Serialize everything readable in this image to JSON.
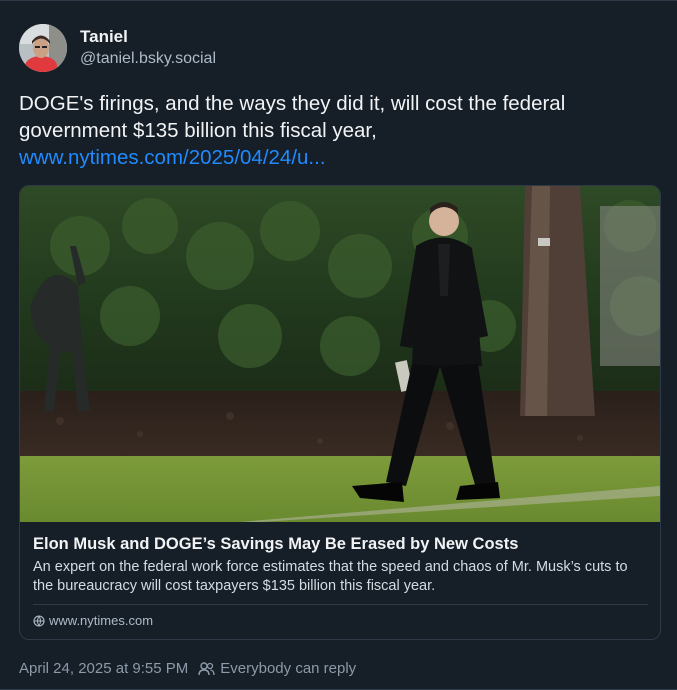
{
  "author": {
    "display_name": "Taniel",
    "handle": "@taniel.bsky.social",
    "avatar_icon": "avatar-photo"
  },
  "post": {
    "text": "DOGE's firings, and the ways they did it, will cost the federal government $135 billion this fiscal year,",
    "link_text": "www.nytimes.com/2025/04/24/u..."
  },
  "card": {
    "title": "Elon Musk and DOGE’s Savings May Be Erased by New Costs",
    "description": "An expert on the federal work force estimates that the speed and chaos of Mr. Musk’s cuts to the bureaucracy will cost taxpayers $135 billion this fiscal year.",
    "domain": "www.nytimes.com",
    "domain_icon": "globe-icon"
  },
  "meta": {
    "timestamp": "April 24, 2025 at 9:55 PM",
    "reply_setting": "Everybody can reply",
    "reply_icon": "people-icon"
  },
  "colors": {
    "background": "#161e27",
    "link": "#208bfe",
    "border": "#2e3a47",
    "muted_text": "#8c9aa9"
  }
}
